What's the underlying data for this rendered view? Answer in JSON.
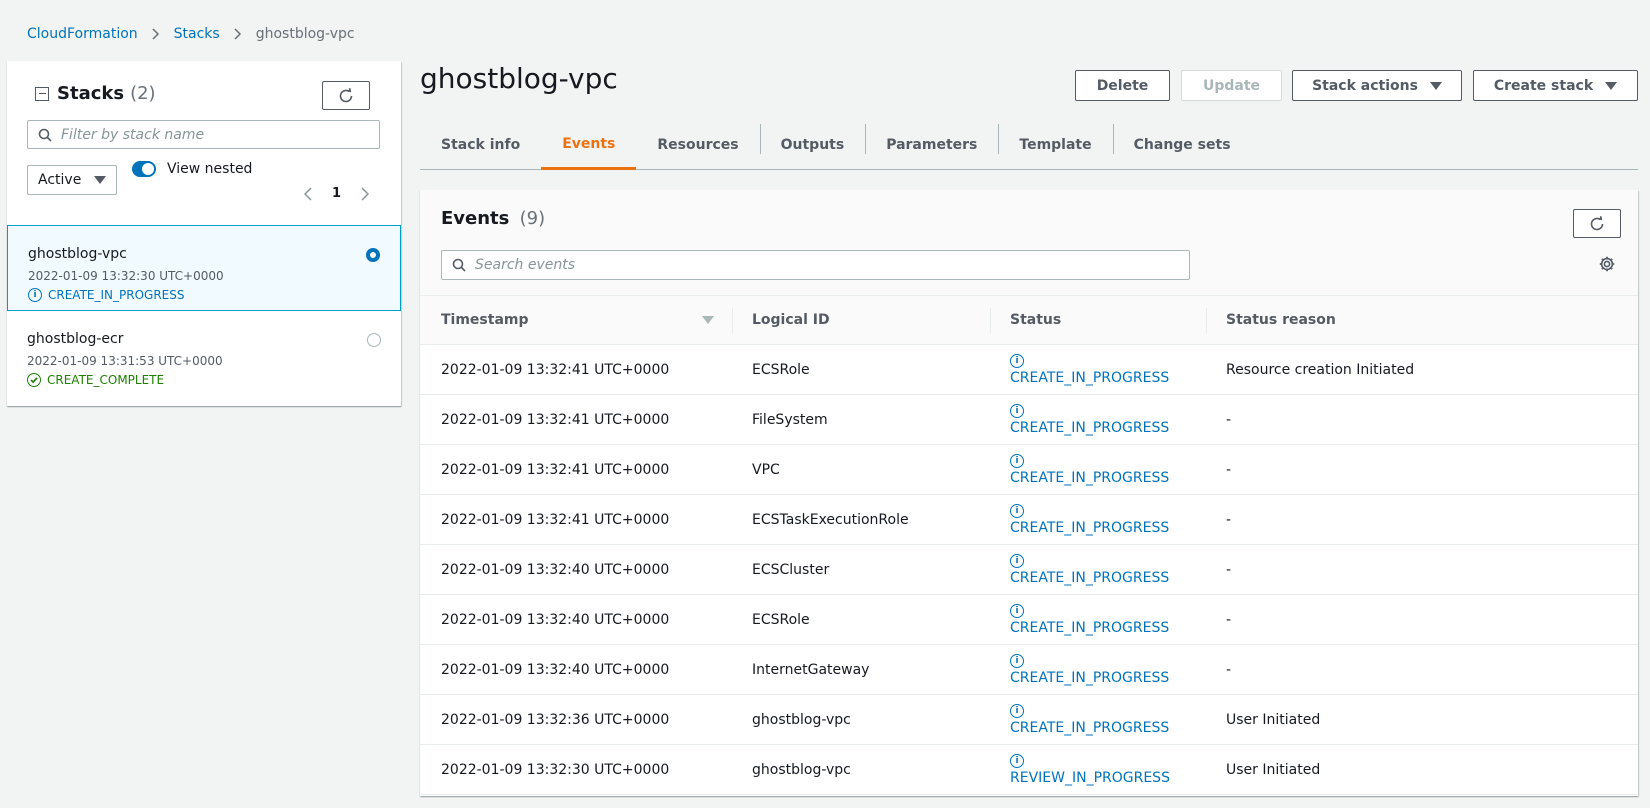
{
  "breadcrumb": {
    "items": [
      "CloudFormation",
      "Stacks",
      "ghostblog-vpc"
    ]
  },
  "sidebar": {
    "title": "Stacks",
    "count": "(2)",
    "search_placeholder": "Filter by stack name",
    "filter_value": "Active",
    "toggle_label": "View nested",
    "page": "1",
    "stacks": [
      {
        "name": "ghostblog-vpc",
        "time": "2022-01-09 13:32:30 UTC+0000",
        "status": "CREATE_IN_PROGRESS",
        "selected": true
      },
      {
        "name": "ghostblog-ecr",
        "time": "2022-01-09 13:31:53 UTC+0000",
        "status": "CREATE_COMPLETE",
        "selected": false
      }
    ]
  },
  "header": {
    "title": "ghostblog-vpc",
    "buttons": {
      "delete": "Delete",
      "update": "Update",
      "stack_actions": "Stack actions",
      "create_stack": "Create stack"
    }
  },
  "tabs": [
    "Stack info",
    "Events",
    "Resources",
    "Outputs",
    "Parameters",
    "Template",
    "Change sets"
  ],
  "active_tab": "Events",
  "events": {
    "title": "Events",
    "count": "(9)",
    "search_placeholder": "Search events",
    "columns": [
      "Timestamp",
      "Logical ID",
      "Status",
      "Status reason"
    ],
    "rows": [
      {
        "timestamp": "2022-01-09 13:32:41 UTC+0000",
        "logical_id": "ECSRole",
        "status": "CREATE_IN_PROGRESS",
        "reason": "Resource creation Initiated"
      },
      {
        "timestamp": "2022-01-09 13:32:41 UTC+0000",
        "logical_id": "FileSystem",
        "status": "CREATE_IN_PROGRESS",
        "reason": "-"
      },
      {
        "timestamp": "2022-01-09 13:32:41 UTC+0000",
        "logical_id": "VPC",
        "status": "CREATE_IN_PROGRESS",
        "reason": "-"
      },
      {
        "timestamp": "2022-01-09 13:32:41 UTC+0000",
        "logical_id": "ECSTaskExecutionRole",
        "status": "CREATE_IN_PROGRESS",
        "reason": "-"
      },
      {
        "timestamp": "2022-01-09 13:32:40 UTC+0000",
        "logical_id": "ECSCluster",
        "status": "CREATE_IN_PROGRESS",
        "reason": "-"
      },
      {
        "timestamp": "2022-01-09 13:32:40 UTC+0000",
        "logical_id": "ECSRole",
        "status": "CREATE_IN_PROGRESS",
        "reason": "-"
      },
      {
        "timestamp": "2022-01-09 13:32:40 UTC+0000",
        "logical_id": "InternetGateway",
        "status": "CREATE_IN_PROGRESS",
        "reason": "-"
      },
      {
        "timestamp": "2022-01-09 13:32:36 UTC+0000",
        "logical_id": "ghostblog-vpc",
        "status": "CREATE_IN_PROGRESS",
        "reason": "User Initiated"
      },
      {
        "timestamp": "2022-01-09 13:32:30 UTC+0000",
        "logical_id": "ghostblog-vpc",
        "status": "REVIEW_IN_PROGRESS",
        "reason": "User Initiated"
      }
    ]
  },
  "colors": {
    "link": "#0073bb",
    "accent": "#ec7211",
    "success": "#1d8102",
    "background": "#f2f3f3"
  }
}
